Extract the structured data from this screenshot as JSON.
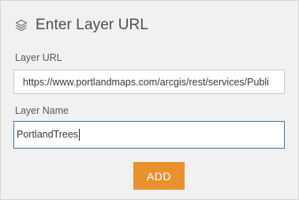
{
  "dialog": {
    "title": "Enter Layer URL",
    "icon": "layers-icon"
  },
  "fields": {
    "url": {
      "label": "Layer URL",
      "value": "https://www.portlandmaps.com/arcgis/rest/services/Publi"
    },
    "name": {
      "label": "Layer Name",
      "value": "PortlandTrees"
    }
  },
  "actions": {
    "add_label": "ADD"
  },
  "colors": {
    "accent": "#e9912e",
    "panel_background": "#f1f1f1",
    "focus_border": "#4a6ea8"
  }
}
